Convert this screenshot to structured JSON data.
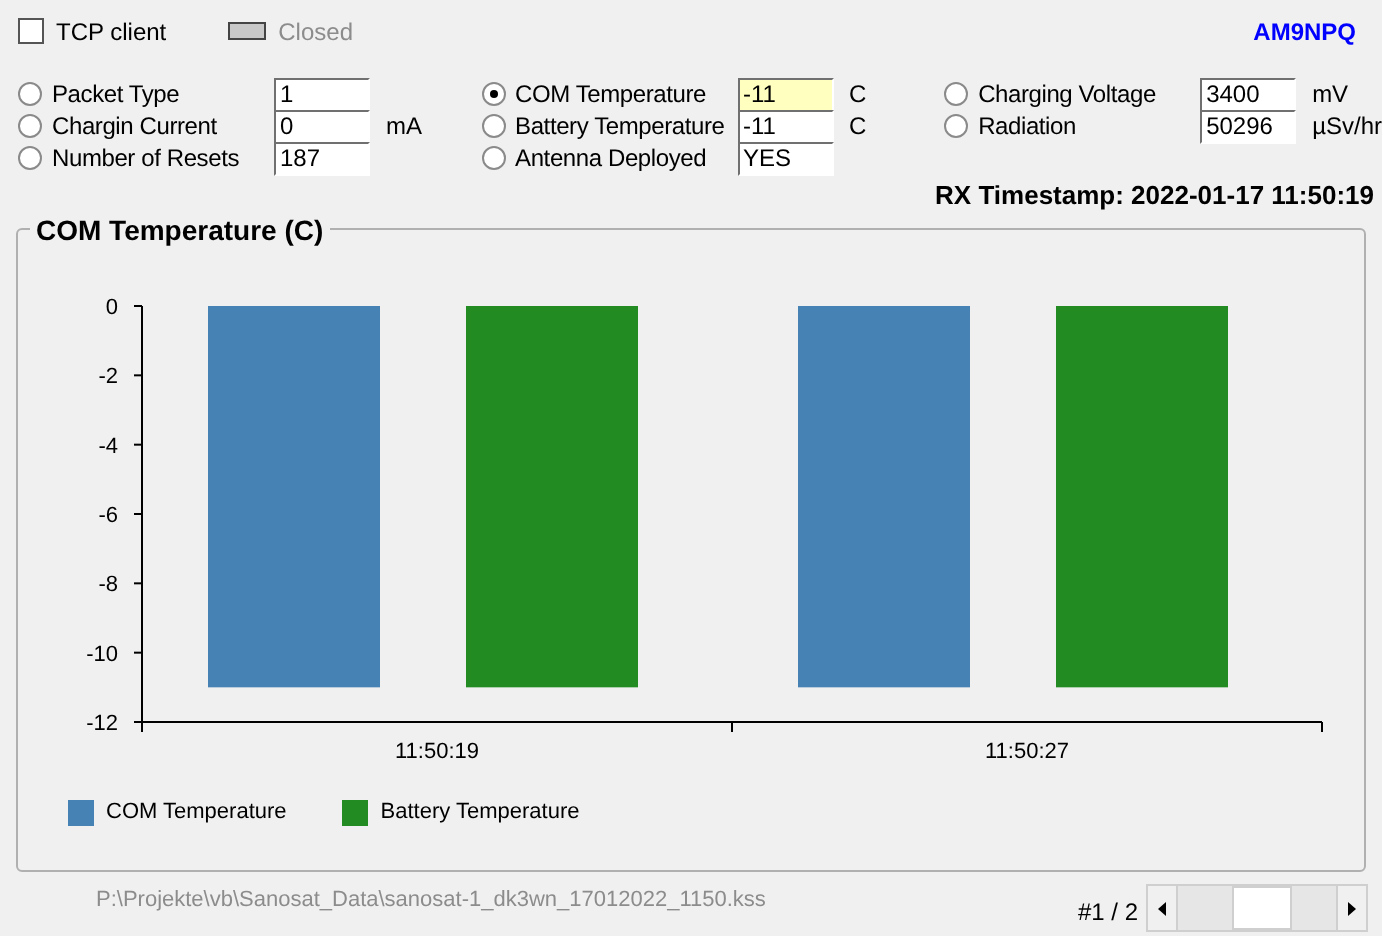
{
  "tcp_client": {
    "label": "TCP client",
    "checked": false
  },
  "connection_status": "Closed",
  "callsign": "AM9NPQ",
  "fields": [
    [
      {
        "label": "Packet Type",
        "selected": false,
        "value": "1",
        "highlighted": false
      },
      {
        "label": "Chargin Current",
        "selected": false,
        "value": "0",
        "unit": "mA",
        "highlighted": false
      },
      {
        "label": "Number of Resets",
        "selected": false,
        "value": "187",
        "highlighted": false
      }
    ],
    [
      {
        "label": "COM Temperature",
        "selected": true,
        "value": "-11",
        "unit": "C",
        "highlighted": true
      },
      {
        "label": "Battery Temperature",
        "selected": false,
        "value": "-11",
        "unit": "C",
        "highlighted": false
      },
      {
        "label": "Antenna Deployed",
        "selected": false,
        "value": "YES",
        "highlighted": false
      }
    ],
    [
      {
        "label": "Charging Voltage",
        "selected": false,
        "value": "3400",
        "unit": "mV",
        "highlighted": false
      },
      {
        "label": "Radiation",
        "selected": false,
        "value": "50296",
        "unit": "µSv/hr",
        "highlighted": false
      }
    ]
  ],
  "rx_timestamp": "RX Timestamp: 2022-01-17 11:50:19",
  "chart_panel": {
    "title": "COM Temperature (C)",
    "chart_data": {
      "type": "bar",
      "categories": [
        "11:50:19",
        "11:50:27"
      ],
      "series": [
        {
          "name": "COM Temperature",
          "color": "#4682b4",
          "values": [
            -11,
            -11
          ]
        },
        {
          "name": "Battery Temperature",
          "color": "#228b22",
          "values": [
            -11,
            -11
          ]
        }
      ],
      "ylim": [
        -12,
        0
      ],
      "yticks": [
        0,
        -2,
        -4,
        -6,
        -8,
        -10,
        -12
      ]
    }
  },
  "file_path": "P:\\Projekte\\vb\\Sanosat_Data\\sanosat-1_dk3wn_17012022_1150.kss",
  "record_counter": "#1 / 2"
}
